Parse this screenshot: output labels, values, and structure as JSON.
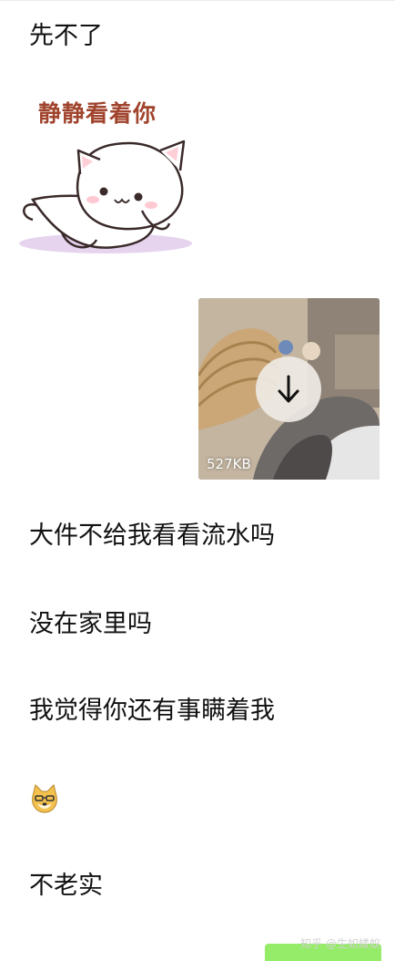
{
  "messages": {
    "m1_text": "先不了",
    "sticker_caption": "静静看着你",
    "video": {
      "file_size": "527KB",
      "icon": "download-arrow-icon"
    },
    "m2_text": "大件不给我看看流水吗",
    "m3_text": "没在家里吗",
    "m4_text": "我觉得你还有事瞒着我",
    "emoji_icon": "doge-emoji-icon",
    "m5_text": "不老实"
  },
  "watermark": "知乎 @生如蝼蚁",
  "colors": {
    "self_bubble": "#95ec69",
    "text": "#111111",
    "sticker_caption": "#a0442e"
  }
}
